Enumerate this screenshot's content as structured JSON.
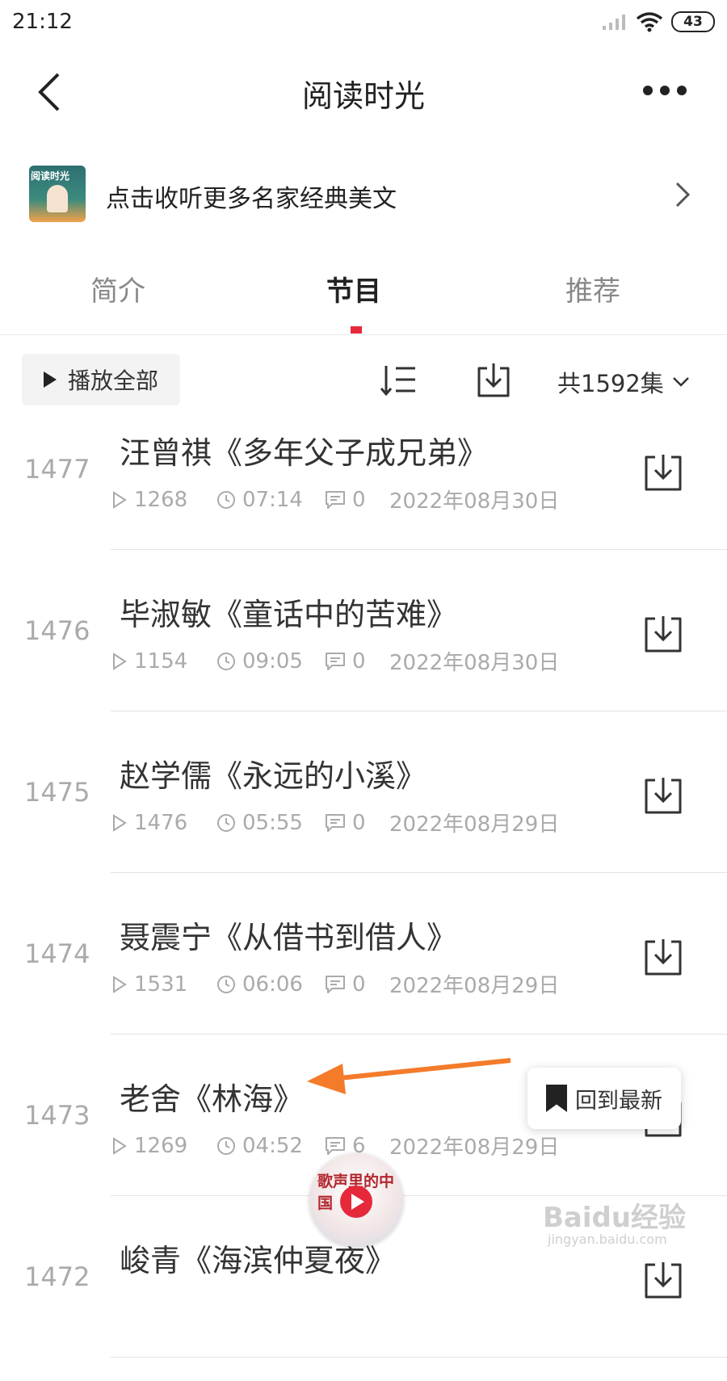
{
  "status_bar": {
    "time": "21:12",
    "battery": "43"
  },
  "header": {
    "title": "阅读时光"
  },
  "banner": {
    "thumb_title": "阅读时光",
    "text": "点击收听更多名家经典美文"
  },
  "tabs": [
    {
      "label": "简介",
      "active": false
    },
    {
      "label": "节目",
      "active": true
    },
    {
      "label": "推荐",
      "active": false
    }
  ],
  "toolbar": {
    "play_all": "播放全部",
    "episode_count": "共1592集"
  },
  "episodes": [
    {
      "number": "1477",
      "title": "汪曾祺《多年父子成兄弟》",
      "plays": "1268",
      "duration": "07:14",
      "comments": "0",
      "date": "2022年08月30日"
    },
    {
      "number": "1476",
      "title": "毕淑敏《童话中的苦难》",
      "plays": "1154",
      "duration": "09:05",
      "comments": "0",
      "date": "2022年08月30日"
    },
    {
      "number": "1475",
      "title": "赵学儒《永远的小溪》",
      "plays": "1476",
      "duration": "05:55",
      "comments": "0",
      "date": "2022年08月29日"
    },
    {
      "number": "1474",
      "title": "聂震宁《从借书到借人》",
      "plays": "1531",
      "duration": "06:06",
      "comments": "0",
      "date": "2022年08月29日"
    },
    {
      "number": "1473",
      "title": "老舍《林海》",
      "plays": "1269",
      "duration": "04:52",
      "comments": "6",
      "date": "2022年08月29日"
    },
    {
      "number": "1472",
      "title": "峻青《海滨仲夏夜》",
      "plays": "",
      "duration": "",
      "comments": "",
      "date": ""
    }
  ],
  "floating": {
    "back_to_latest": "回到最新"
  },
  "mini_player": {
    "cover_text": "歌声里的中国"
  },
  "watermark": {
    "text": "Baidu经验",
    "sub": "jingyan.baidu.com"
  },
  "colors": {
    "accent": "#e5293b",
    "annotation_arrow": "#f47b2a"
  }
}
